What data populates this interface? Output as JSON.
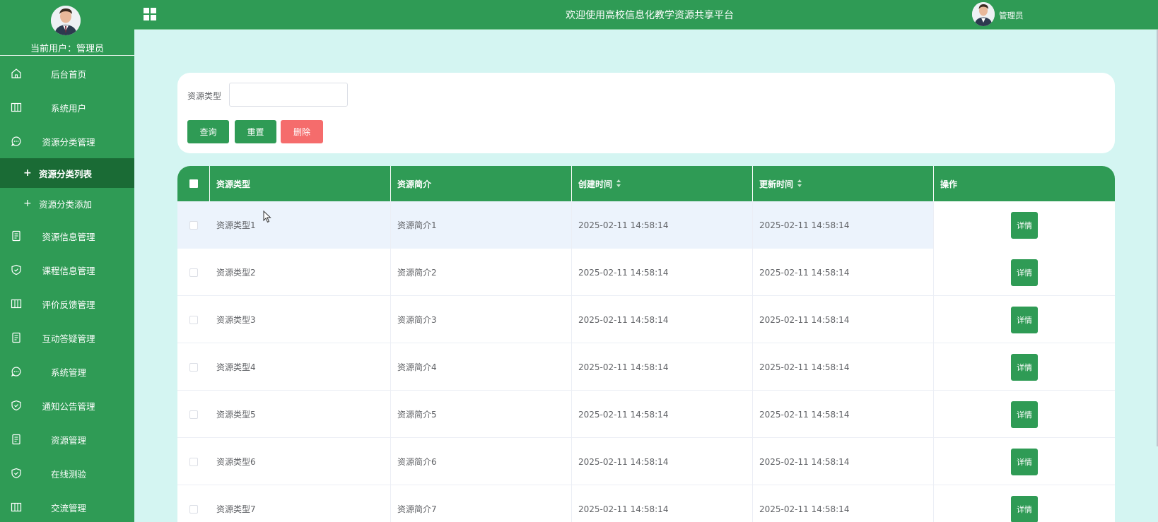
{
  "sidebar": {
    "current_user": "当前用户：管理员",
    "menu": [
      {
        "label": "后台首页",
        "icon": "home-icon"
      },
      {
        "label": "系统用户",
        "icon": "columns-icon"
      },
      {
        "label": "资源分类管理",
        "icon": "chat-icon"
      },
      {
        "label": "资源信息管理",
        "icon": "document-icon"
      },
      {
        "label": "课程信息管理",
        "icon": "shield-check-icon"
      },
      {
        "label": "评价反馈管理",
        "icon": "columns-icon"
      },
      {
        "label": "互动答疑管理",
        "icon": "document-icon"
      },
      {
        "label": "系统管理",
        "icon": "chat-icon"
      },
      {
        "label": "通知公告管理",
        "icon": "shield-check-icon"
      },
      {
        "label": "资源管理",
        "icon": "document-icon"
      },
      {
        "label": "在线测验",
        "icon": "shield-check-icon"
      },
      {
        "label": "交流管理",
        "icon": "columns-icon"
      }
    ],
    "submenu": [
      {
        "label": "资源分类列表",
        "active": true
      },
      {
        "label": "资源分类添加",
        "active": false
      }
    ]
  },
  "header": {
    "title": "欢迎使用高校信息化教学资源共享平台",
    "user": "管理员"
  },
  "search": {
    "label": "资源类型",
    "value": "",
    "query_button": "查询",
    "reset_button": "重置",
    "delete_button": "删除"
  },
  "table": {
    "columns": [
      "资源类型",
      "资源简介",
      "创建时间",
      "更新时间",
      "操作"
    ],
    "rows": [
      {
        "type": "资源类型1",
        "intro": "资源简介1",
        "created": "2025-02-11 14:58:14",
        "updated": "2025-02-11 14:58:14"
      },
      {
        "type": "资源类型2",
        "intro": "资源简介2",
        "created": "2025-02-11 14:58:14",
        "updated": "2025-02-11 14:58:14"
      },
      {
        "type": "资源类型3",
        "intro": "资源简介3",
        "created": "2025-02-11 14:58:14",
        "updated": "2025-02-11 14:58:14"
      },
      {
        "type": "资源类型4",
        "intro": "资源简介4",
        "created": "2025-02-11 14:58:14",
        "updated": "2025-02-11 14:58:14"
      },
      {
        "type": "资源类型5",
        "intro": "资源简介5",
        "created": "2025-02-11 14:58:14",
        "updated": "2025-02-11 14:58:14"
      },
      {
        "type": "资源类型6",
        "intro": "资源简介6",
        "created": "2025-02-11 14:58:14",
        "updated": "2025-02-11 14:58:14"
      },
      {
        "type": "资源类型7",
        "intro": "资源简介7",
        "created": "2025-02-11 14:58:14",
        "updated": "2025-02-11 14:58:14"
      }
    ],
    "detail_button": "详情"
  },
  "colors": {
    "primary": "#2f9b55",
    "sidebar_active": "#1a6b35",
    "danger": "#f56c6c",
    "background": "#d4f5f2"
  }
}
